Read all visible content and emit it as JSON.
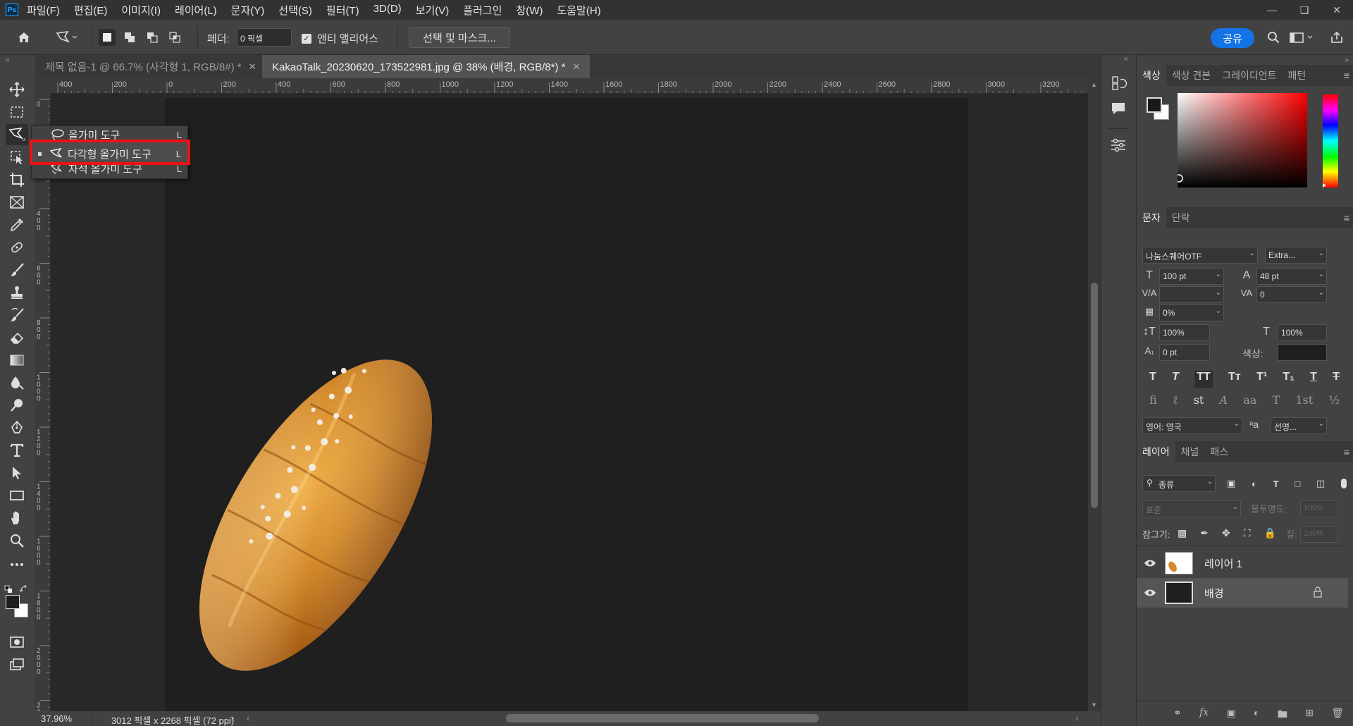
{
  "app": {
    "logo_text": "Ps"
  },
  "menubar": {
    "items": [
      "파일(F)",
      "편집(E)",
      "이미지(I)",
      "레이어(L)",
      "문자(Y)",
      "선택(S)",
      "필터(T)",
      "3D(D)",
      "보기(V)",
      "플러그인",
      "창(W)",
      "도움말(H)"
    ],
    "window_controls": [
      "minimize-icon",
      "restore-icon",
      "close-icon"
    ]
  },
  "options_bar": {
    "feather_label": "페더:",
    "feather_value": "0 픽셀",
    "anti_alias_label": "앤티 앨리어스",
    "anti_alias_checked": true,
    "select_mask_label": "선택 및 마스크...",
    "share_label": "공유"
  },
  "tabs": [
    {
      "label": "제목 없음-1 @ 66.7% (사각형 1, RGB/8#) *",
      "active": false
    },
    {
      "label": "KakaoTalk_20230620_173522981.jpg @ 38% (배경, RGB/8*) *",
      "active": true
    }
  ],
  "ruler": {
    "h_labels": [
      "400",
      "200",
      "0",
      "200",
      "400",
      "600",
      "800",
      "1000",
      "1200",
      "1400",
      "1600",
      "1800",
      "2000",
      "2200",
      "2400",
      "2600",
      "2800",
      "3000",
      "3200",
      "34"
    ],
    "v_labels": [
      "0",
      "2\n0\n0",
      "4\n0\n0",
      "6\n0\n0",
      "8\n0\n0",
      "1\n0\n0\n0",
      "1\n2\n0\n0",
      "1\n4\n0\n0",
      "1\n6\n0\n0",
      "1\n8\n0\n0",
      "2\n0\n0\n0",
      "2\n2\n0\n0"
    ]
  },
  "status": {
    "zoom": "37.96%",
    "doc_info": "3012 픽셀 x 2268 픽셀 (72 ppi)"
  },
  "lasso_popup": {
    "items": [
      {
        "label": "올가미 도구",
        "key": "L",
        "icon": "lasso-icon"
      },
      {
        "label": "다각형 올가미 도구",
        "key": "L",
        "icon": "polygonal-lasso-icon",
        "selected": true
      },
      {
        "label": "자석 올가미 도구",
        "key": "L",
        "icon": "magnetic-lasso-icon"
      }
    ]
  },
  "color_panel": {
    "tabs": [
      "색상",
      "색상 견본",
      "그레이디언트",
      "패턴"
    ]
  },
  "char_panel": {
    "tabs": [
      "문자",
      "단락"
    ],
    "font_family": "나눔스퀘어OTF",
    "font_style": "Extra...",
    "font_size": "100 pt",
    "leading": "48 pt",
    "kerning": "",
    "tracking": "0",
    "tsume": "0%",
    "vscale": "100%",
    "hscale": "100%",
    "baseline": "0 pt",
    "color_label": "색상:",
    "language": "영어: 영국",
    "aa_label": "a",
    "aa_value": "선명..."
  },
  "layers_panel": {
    "tabs": [
      "레이어",
      "채널",
      "패스"
    ],
    "filter_kind": "종류",
    "blend_mode": "표준",
    "opacity_label": "불투명도:",
    "opacity_value": "100%",
    "lock_label": "잠그기:",
    "fill_label": "칠:",
    "fill_value": "100%",
    "layers": [
      {
        "name": "레이어 1",
        "visible": true,
        "locked": false
      },
      {
        "name": "배경",
        "visible": true,
        "locked": true
      }
    ]
  },
  "colors": {
    "accent": "#1473e6",
    "highlight_border": "#e11111",
    "bread": "#d48a2a"
  }
}
